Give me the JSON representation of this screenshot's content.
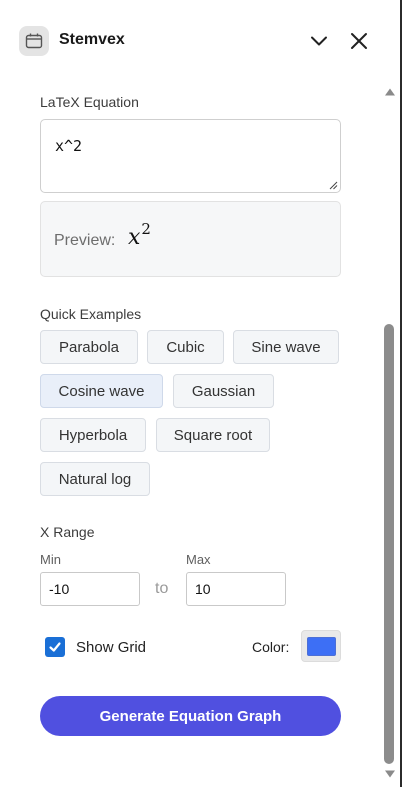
{
  "app": {
    "title": "Stemvex"
  },
  "latex": {
    "label": "LaTeX Equation",
    "value": "x^2",
    "preview_label": "Preview:",
    "preview_base": "x",
    "preview_exp": "2"
  },
  "quick_examples": {
    "label": "Quick Examples",
    "items": [
      "Parabola",
      "Cubic",
      "Sine wave",
      "Cosine wave",
      "Gaussian",
      "Hyperbola",
      "Square root",
      "Natural log"
    ],
    "selected": "Cosine wave"
  },
  "x_range": {
    "label": "X Range",
    "min_label": "Min",
    "max_label": "Max",
    "min_value": "-10",
    "max_value": "10",
    "to_label": "to"
  },
  "options": {
    "show_grid_label": "Show Grid",
    "show_grid_checked": true,
    "color_label": "Color:",
    "graph_color": "#3d6ff5"
  },
  "generate_button": {
    "label": "Generate Equation Graph",
    "color": "#5050e0"
  },
  "icons": {
    "app": "calendar-icon",
    "collapse": "chevron-down-icon",
    "close": "close-icon"
  }
}
